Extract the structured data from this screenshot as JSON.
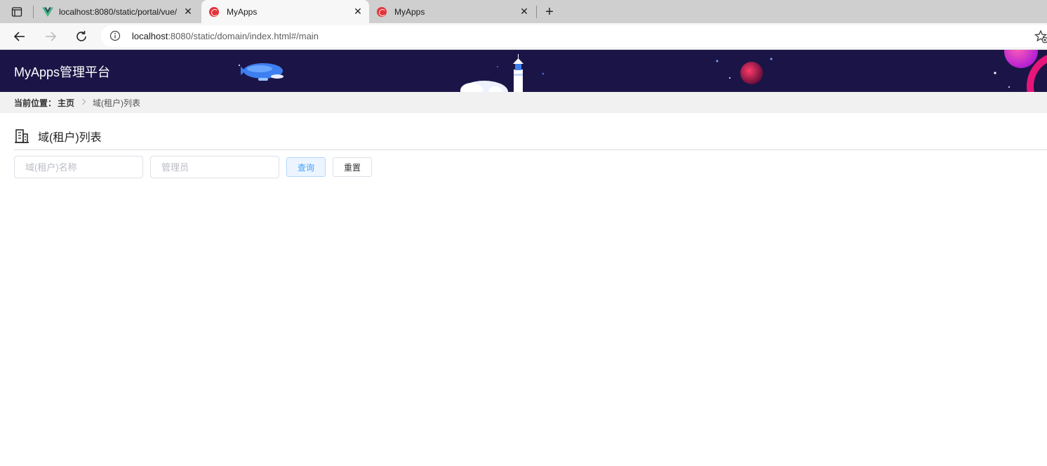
{
  "browser": {
    "tabs": [
      {
        "title": "localhost:8080/static/portal/vue/",
        "favicon": "vue-logo-icon",
        "active": false
      },
      {
        "title": "MyApps",
        "favicon": "myapps-logo-icon",
        "active": true
      },
      {
        "title": "MyApps",
        "favicon": "myapps-logo-icon",
        "active": false
      }
    ],
    "close_glyph": "✕",
    "new_tab_glyph": "+",
    "address": {
      "host": "localhost",
      "rest": ":8080/static/domain/index.html#/main"
    }
  },
  "app": {
    "title": "MyApps管理平台",
    "header_color": "#1b1547"
  },
  "breadcrumb": {
    "label": "当前位置：",
    "home": "主页",
    "current": "域(租户)列表"
  },
  "page": {
    "title": "域(租户)列表"
  },
  "search": {
    "domain_name_placeholder": "域(租户)名称",
    "admin_placeholder": "管理员",
    "query_label": "查询",
    "reset_label": "重置"
  },
  "colors": {
    "accent": "#409eff",
    "accent_light": "#ecf5ff"
  }
}
